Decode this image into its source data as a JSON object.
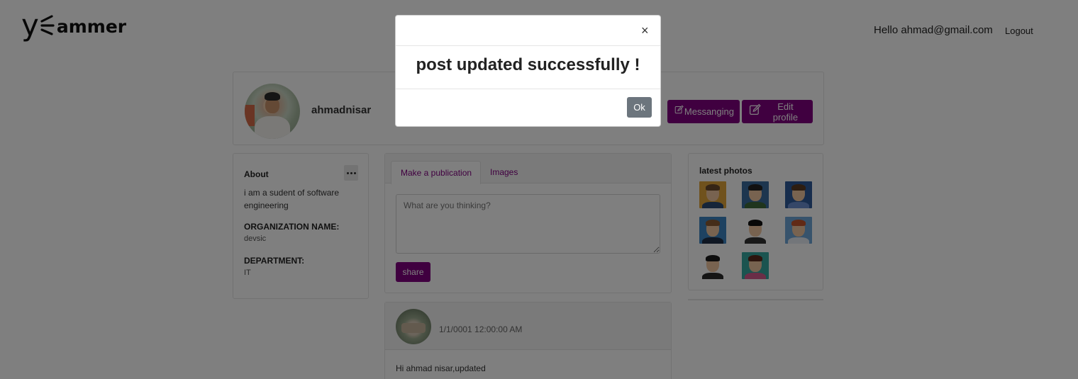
{
  "header": {
    "logo_text": "ammer",
    "greeting": "Hello ahmad@gmail.com",
    "logout_label": "Logout"
  },
  "profile": {
    "username": "ahmadnisar",
    "messaging_label": "Messanging",
    "edit_profile_label": "Edit profile"
  },
  "about": {
    "title": "About",
    "text": "i am a sudent of software engineering",
    "org_label": "ORGANIZATION NAME:",
    "org_value": "devsic",
    "department_label": "DEPARTMENT:",
    "department_value": "IT"
  },
  "publication": {
    "tab_active": "Make a publication",
    "tab_images": "Images",
    "placeholder": "What are you thinking?",
    "share_label": "share"
  },
  "post": {
    "date": "1/1/0001 12:00:00 AM",
    "body": "Hi ahmad nisar,updated"
  },
  "photos": {
    "title": "latest photos",
    "items": [
      {
        "name": "photo-1",
        "bg": "#e0a43a",
        "hair": "#6b4a2c",
        "body": "#2d4a73"
      },
      {
        "name": "photo-2",
        "bg": "#3a6d9e",
        "hair": "#222222",
        "body": "#3e6b3a"
      },
      {
        "name": "photo-3",
        "bg": "#2f5a9a",
        "hair": "#5a3b22",
        "body": "#6a8fd1"
      },
      {
        "name": "photo-4",
        "bg": "#3d84c2",
        "hair": "#8a5b33",
        "body": "#1f2e46"
      },
      {
        "name": "photo-5",
        "bg": "#ffffff",
        "hair": "#111111",
        "body": "#333333"
      },
      {
        "name": "photo-6",
        "bg": "#6ea6d8",
        "hair": "#c2552d",
        "body": "#e7edf5"
      },
      {
        "name": "photo-7",
        "bg": "#ffffff",
        "hair": "#1a1a1a",
        "body": "#2b2b2b"
      },
      {
        "name": "photo-8",
        "bg": "#37a8a0",
        "hair": "#5a2b1c",
        "body": "#d45c8e"
      }
    ]
  },
  "modal": {
    "close_glyph": "×",
    "message": "post updated successfully !",
    "ok_label": "Ok"
  },
  "colors": {
    "brand_purple": "#800080",
    "ok_button": "#6c757d",
    "overlay": "rgba(0,0,0,0.5)"
  }
}
